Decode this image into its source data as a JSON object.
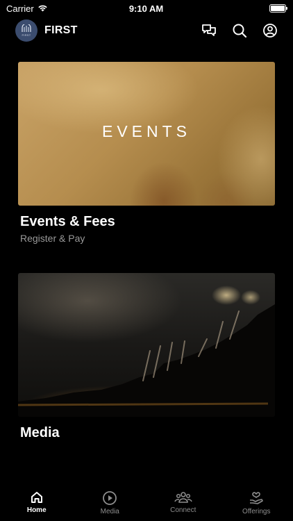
{
  "status_bar": {
    "carrier": "Carrier",
    "time": "9:10 AM"
  },
  "header": {
    "logo_text": "FIRST",
    "app_name": "FIRST",
    "icons": [
      "chat-icon",
      "search-icon",
      "profile-icon"
    ]
  },
  "cards": [
    {
      "image_label": "EVENTS",
      "title": "Events & Fees",
      "subtitle": "Register & Pay"
    },
    {
      "image_label": "",
      "title": "Media",
      "subtitle": ""
    }
  ],
  "tabs": [
    {
      "label": "Home",
      "icon": "home-icon",
      "active": true
    },
    {
      "label": "Media",
      "icon": "play-circle-icon",
      "active": false
    },
    {
      "label": "Connect",
      "icon": "people-icon",
      "active": false
    },
    {
      "label": "Offerings",
      "icon": "heart-hand-icon",
      "active": false
    }
  ],
  "colors": {
    "background": "#000000",
    "active_tab": "#ffffff",
    "inactive_tab": "#8e8e8e",
    "logo_bg": "#3b4c6e"
  }
}
